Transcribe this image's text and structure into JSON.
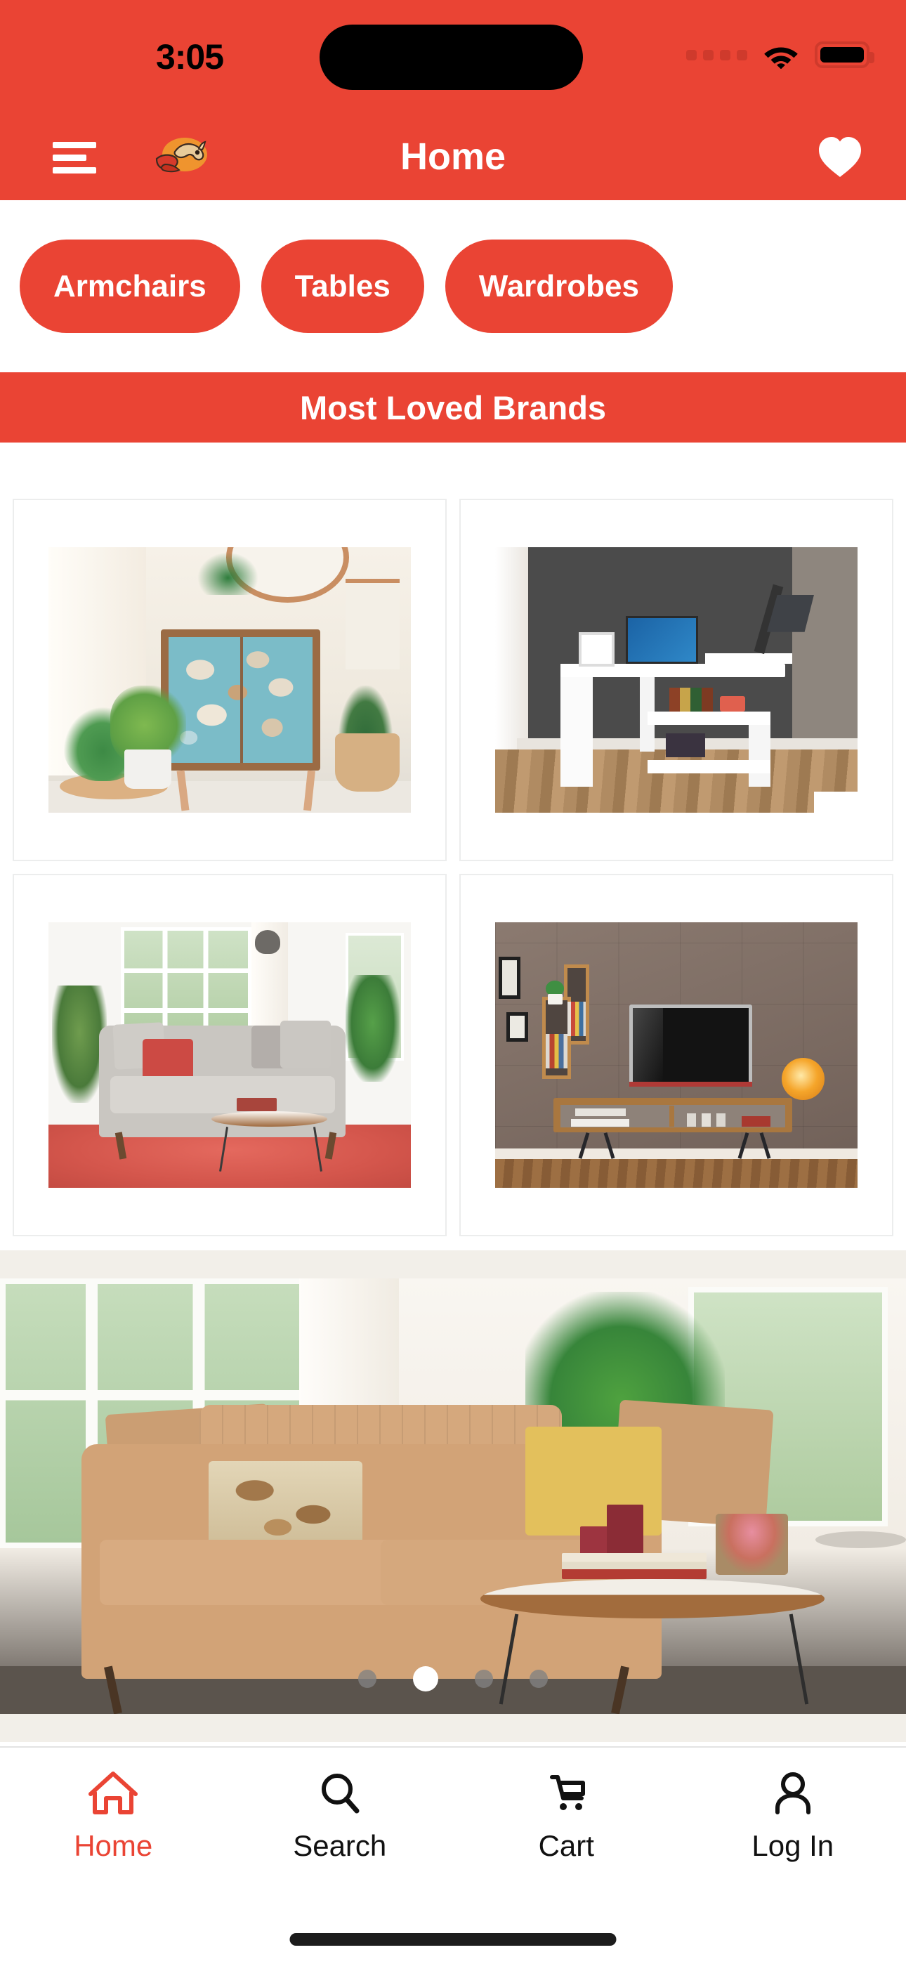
{
  "status_bar": {
    "time": "3:05",
    "cellular_icon": "cellular-dots-icon",
    "wifi_icon": "wifi-icon",
    "battery_icon": "battery-full-icon"
  },
  "header": {
    "menu_icon": "hamburger-menu-icon",
    "logo_icon": "camel-mascot-logo",
    "title": "Home",
    "favorites_icon": "heart-icon"
  },
  "categories": {
    "chips": [
      {
        "label": "Armchairs"
      },
      {
        "label": "Tables"
      },
      {
        "label": "Wardrobes"
      }
    ]
  },
  "section": {
    "banner_title": "Most Loved Brands"
  },
  "product_grid": {
    "items": [
      {
        "name": "floral-teal-cabinet",
        "alt": "Teal floral patterned two-door cabinet in a bright room with plants and round mirror"
      },
      {
        "name": "white-corner-desk",
        "alt": "White L-shaped corner computer desk with laptop, lamp and shelving against a dark grey wall"
      },
      {
        "name": "grey-sofa-set",
        "alt": "Light grey three-seat sofa with red cushion, round coffee table and red patterned rug"
      },
      {
        "name": "wooden-tv-unit",
        "alt": "Wooden TV stand wall unit with flat screen TV, floating box shelves and orange lamp"
      }
    ]
  },
  "carousel": {
    "slide_alt": "Beige fabric sofa with patterned and yellow cushions beside a round wooden coffee table",
    "dots": [
      {
        "active": false
      },
      {
        "active": true
      },
      {
        "active": false
      },
      {
        "active": false
      }
    ]
  },
  "bottom_nav": {
    "items": [
      {
        "label": "Home",
        "icon": "home-icon",
        "active": true
      },
      {
        "label": "Search",
        "icon": "search-icon",
        "active": false
      },
      {
        "label": "Cart",
        "icon": "cart-icon",
        "active": false
      },
      {
        "label": "Log In",
        "icon": "person-icon",
        "active": false
      }
    ]
  },
  "colors": {
    "brand_red": "#ea4434",
    "status_bar_red": "#ea4434",
    "active_tab": "#ea4434",
    "card_border": "#eceded",
    "page_background": "#ffffff"
  }
}
